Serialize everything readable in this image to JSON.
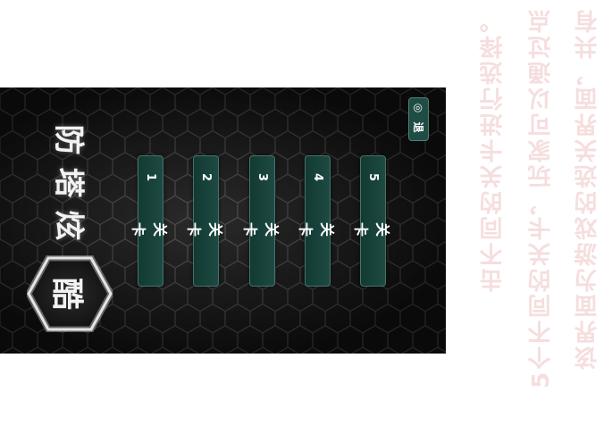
{
  "game": {
    "title_chars": [
      "酷",
      "炫",
      "塔",
      "防"
    ],
    "levels": [
      {
        "label": "关卡",
        "number": "1"
      },
      {
        "label": "关卡",
        "number": "2"
      },
      {
        "label": "关卡",
        "number": "3"
      },
      {
        "label": "关卡",
        "number": "4"
      },
      {
        "label": "关卡",
        "number": "5"
      }
    ],
    "tool": {
      "icon": "◎",
      "label": "退"
    }
  },
  "caption": {
    "lines": [
      "该界面为游戏的选关界面，共有",
      "5个不同的关卡，玩家可以通过点",
      "击不同的关卡进行选择。"
    ]
  }
}
